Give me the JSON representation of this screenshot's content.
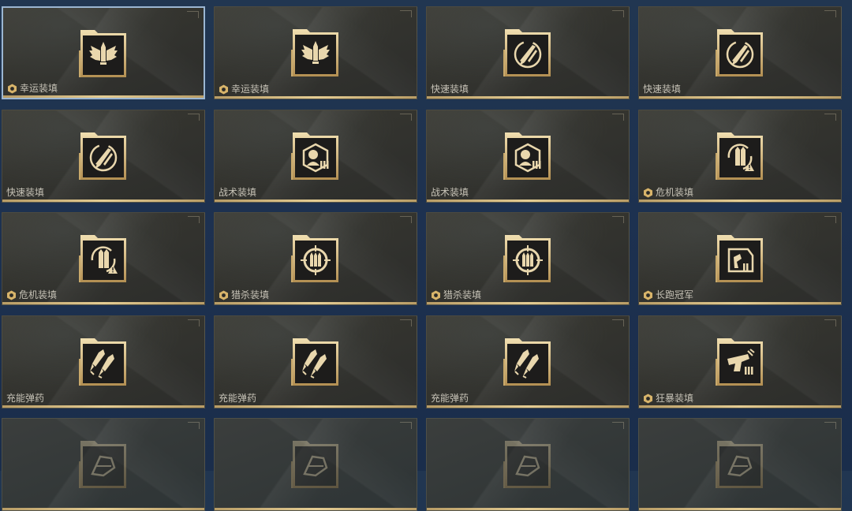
{
  "colors": {
    "accent_gold": "#e4cc93",
    "label_text": "#c7c3b7",
    "badge_gold": "#d8b46a",
    "selected_border": "#9bb6d2"
  },
  "cards": [
    {
      "label": "幸运装填",
      "icon": "winged-bullet-icon",
      "badge": true,
      "selected": true
    },
    {
      "label": "幸运装填",
      "icon": "winged-bullet-icon",
      "badge": true,
      "selected": false
    },
    {
      "label": "快速装填",
      "icon": "rocket-reload-icon",
      "badge": false,
      "selected": false
    },
    {
      "label": "快速装填",
      "icon": "rocket-reload-icon",
      "badge": false,
      "selected": false
    },
    {
      "label": "快速装填",
      "icon": "rocket-reload-icon",
      "badge": false,
      "selected": false
    },
    {
      "label": "战术装填",
      "icon": "target-ammo-icon",
      "badge": false,
      "selected": false
    },
    {
      "label": "战术装填",
      "icon": "target-ammo-icon",
      "badge": false,
      "selected": false
    },
    {
      "label": "危机装填",
      "icon": "crisis-ammo-icon",
      "badge": true,
      "selected": false
    },
    {
      "label": "危机装填",
      "icon": "crisis-ammo-icon",
      "badge": true,
      "selected": false
    },
    {
      "label": "猎杀装填",
      "icon": "crosshair-bullets-icon",
      "badge": true,
      "selected": false
    },
    {
      "label": "猎杀装填",
      "icon": "crosshair-bullets-icon",
      "badge": true,
      "selected": false
    },
    {
      "label": "长跑冠军",
      "icon": "runner-ammo-icon",
      "badge": true,
      "selected": false
    },
    {
      "label": "充能弹药",
      "icon": "charged-bullets-icon",
      "badge": false,
      "selected": false
    },
    {
      "label": "充能弹药",
      "icon": "charged-bullets-icon",
      "badge": false,
      "selected": false
    },
    {
      "label": "充能弹药",
      "icon": "charged-bullets-icon",
      "badge": false,
      "selected": false
    },
    {
      "label": "狂暴装填",
      "icon": "berserk-pistol-icon",
      "badge": true,
      "selected": false
    },
    {
      "label": "",
      "icon": "locked-perk-icon",
      "badge": false,
      "selected": false,
      "faded": true
    },
    {
      "label": "",
      "icon": "locked-perk-icon",
      "badge": false,
      "selected": false,
      "faded": true
    },
    {
      "label": "",
      "icon": "locked-perk-icon",
      "badge": false,
      "selected": false,
      "faded": true
    },
    {
      "label": "",
      "icon": "locked-perk-icon",
      "badge": false,
      "selected": false,
      "faded": true
    }
  ]
}
